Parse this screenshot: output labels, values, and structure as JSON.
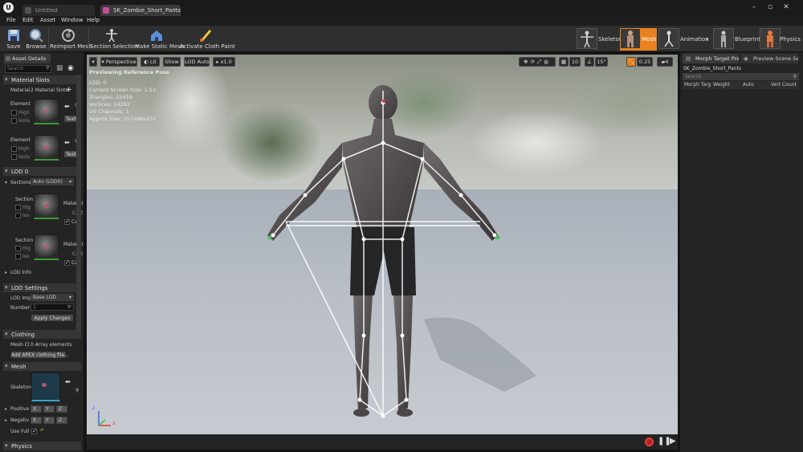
{
  "titlebar": {
    "tabs": [
      {
        "label": "Untitled"
      },
      {
        "label": "SK_Zombie_Short_Pants"
      }
    ],
    "window_buttons": [
      "minimize-icon",
      "maximize-icon",
      "close-icon"
    ]
  },
  "menubar": {
    "items": [
      "File",
      "Edit",
      "Asset",
      "Window",
      "Help"
    ]
  },
  "toolbar": {
    "buttons": [
      {
        "label": "Save",
        "icon": "save-icon"
      },
      {
        "label": "Browse",
        "icon": "browse-icon"
      },
      {
        "label": "Reimport Mesh",
        "icon": "reimport-icon"
      },
      {
        "label": "Section Selection",
        "icon": "section-selection-icon"
      },
      {
        "label": "Make Static Mesh",
        "icon": "static-mesh-icon"
      },
      {
        "label": "Activate Cloth Paint",
        "icon": "cloth-paint-icon"
      }
    ],
    "modes": [
      {
        "label": "Skeleton"
      },
      {
        "label": "Mesh"
      },
      {
        "label": "Animation"
      },
      {
        "label": "Blueprint"
      },
      {
        "label": "Physics"
      }
    ],
    "accent": "#e8821e"
  },
  "asset_details": {
    "tab_label": "Asset Details",
    "search_placeholder": "Search",
    "material_slots": {
      "header": "Material Slots",
      "label": "Material",
      "value": "2 Material Slots",
      "elements": [
        {
          "label": "Element",
          "high": "High",
          "isolate": "Isola",
          "button": "Textu"
        },
        {
          "label": "Element",
          "high": "High",
          "isolate": "Isola",
          "button": "Textu"
        }
      ]
    },
    "lod0": {
      "header": "LOD 0",
      "sections_label": "Sections",
      "sections_value": "Auto (LOD0)",
      "sections": [
        {
          "label": "Section",
          "hi": "Hig",
          "iso": "Iso",
          "mat": "Material",
          "cast": "Cast",
          "ca": "Ca"
        },
        {
          "label": "Section",
          "hi": "Hig",
          "iso": "Iso",
          "mat": "Material",
          "cast": "Cast",
          "ca": "Ca"
        }
      ],
      "lod_info": "LOD Info"
    },
    "lod_settings": {
      "header": "LOD Settings",
      "import_label": "LOD Imp",
      "import_value": "Base LOD",
      "number_label": "Number",
      "number_value": "1",
      "apply_button": "Apply Changes"
    },
    "clothing": {
      "header": "Clothing",
      "mesh_label": "Mesh Cl",
      "mesh_value": "0 Array elements",
      "add_button": "Add APEX clothing file..."
    },
    "mesh": {
      "header": "Mesh",
      "skeleton_label": "Skeleton",
      "positive_label": "Positive",
      "negative_label": "Negativ",
      "use_full_label": "Use Full",
      "xyz": [
        "X",
        "Y",
        "Z"
      ]
    },
    "physics_header": "Physics"
  },
  "viewport": {
    "toolbar": {
      "perspective": "Perspective",
      "lit": "Lit",
      "show": "Show",
      "lod": "LOD Auto",
      "speed": "x1.0",
      "grid": "10",
      "angle": "15°",
      "scale": "0.25",
      "cam": "4"
    },
    "info": {
      "title": "Previewing Reference Pose",
      "lod": "LOD: 0",
      "screen_size": "Current Screen Size: 1.53",
      "triangles": "Triangles: 25419",
      "vertices": "Vertices: 14262",
      "uv": "UV Channels: 1",
      "approx": "Approx Size: 257x66x203"
    },
    "axis": {
      "x": "x",
      "y": "y",
      "z": "z"
    }
  },
  "right_panel": {
    "tabs": [
      {
        "label": "Morph Target Pre"
      },
      {
        "label": "Preview Scene Se"
      }
    ],
    "asset_name": "SK_Zombie_Short_Pants",
    "search_placeholder": "Search",
    "columns": [
      "Morph Targ",
      "Weight",
      "Auto",
      "Vert Count"
    ]
  }
}
